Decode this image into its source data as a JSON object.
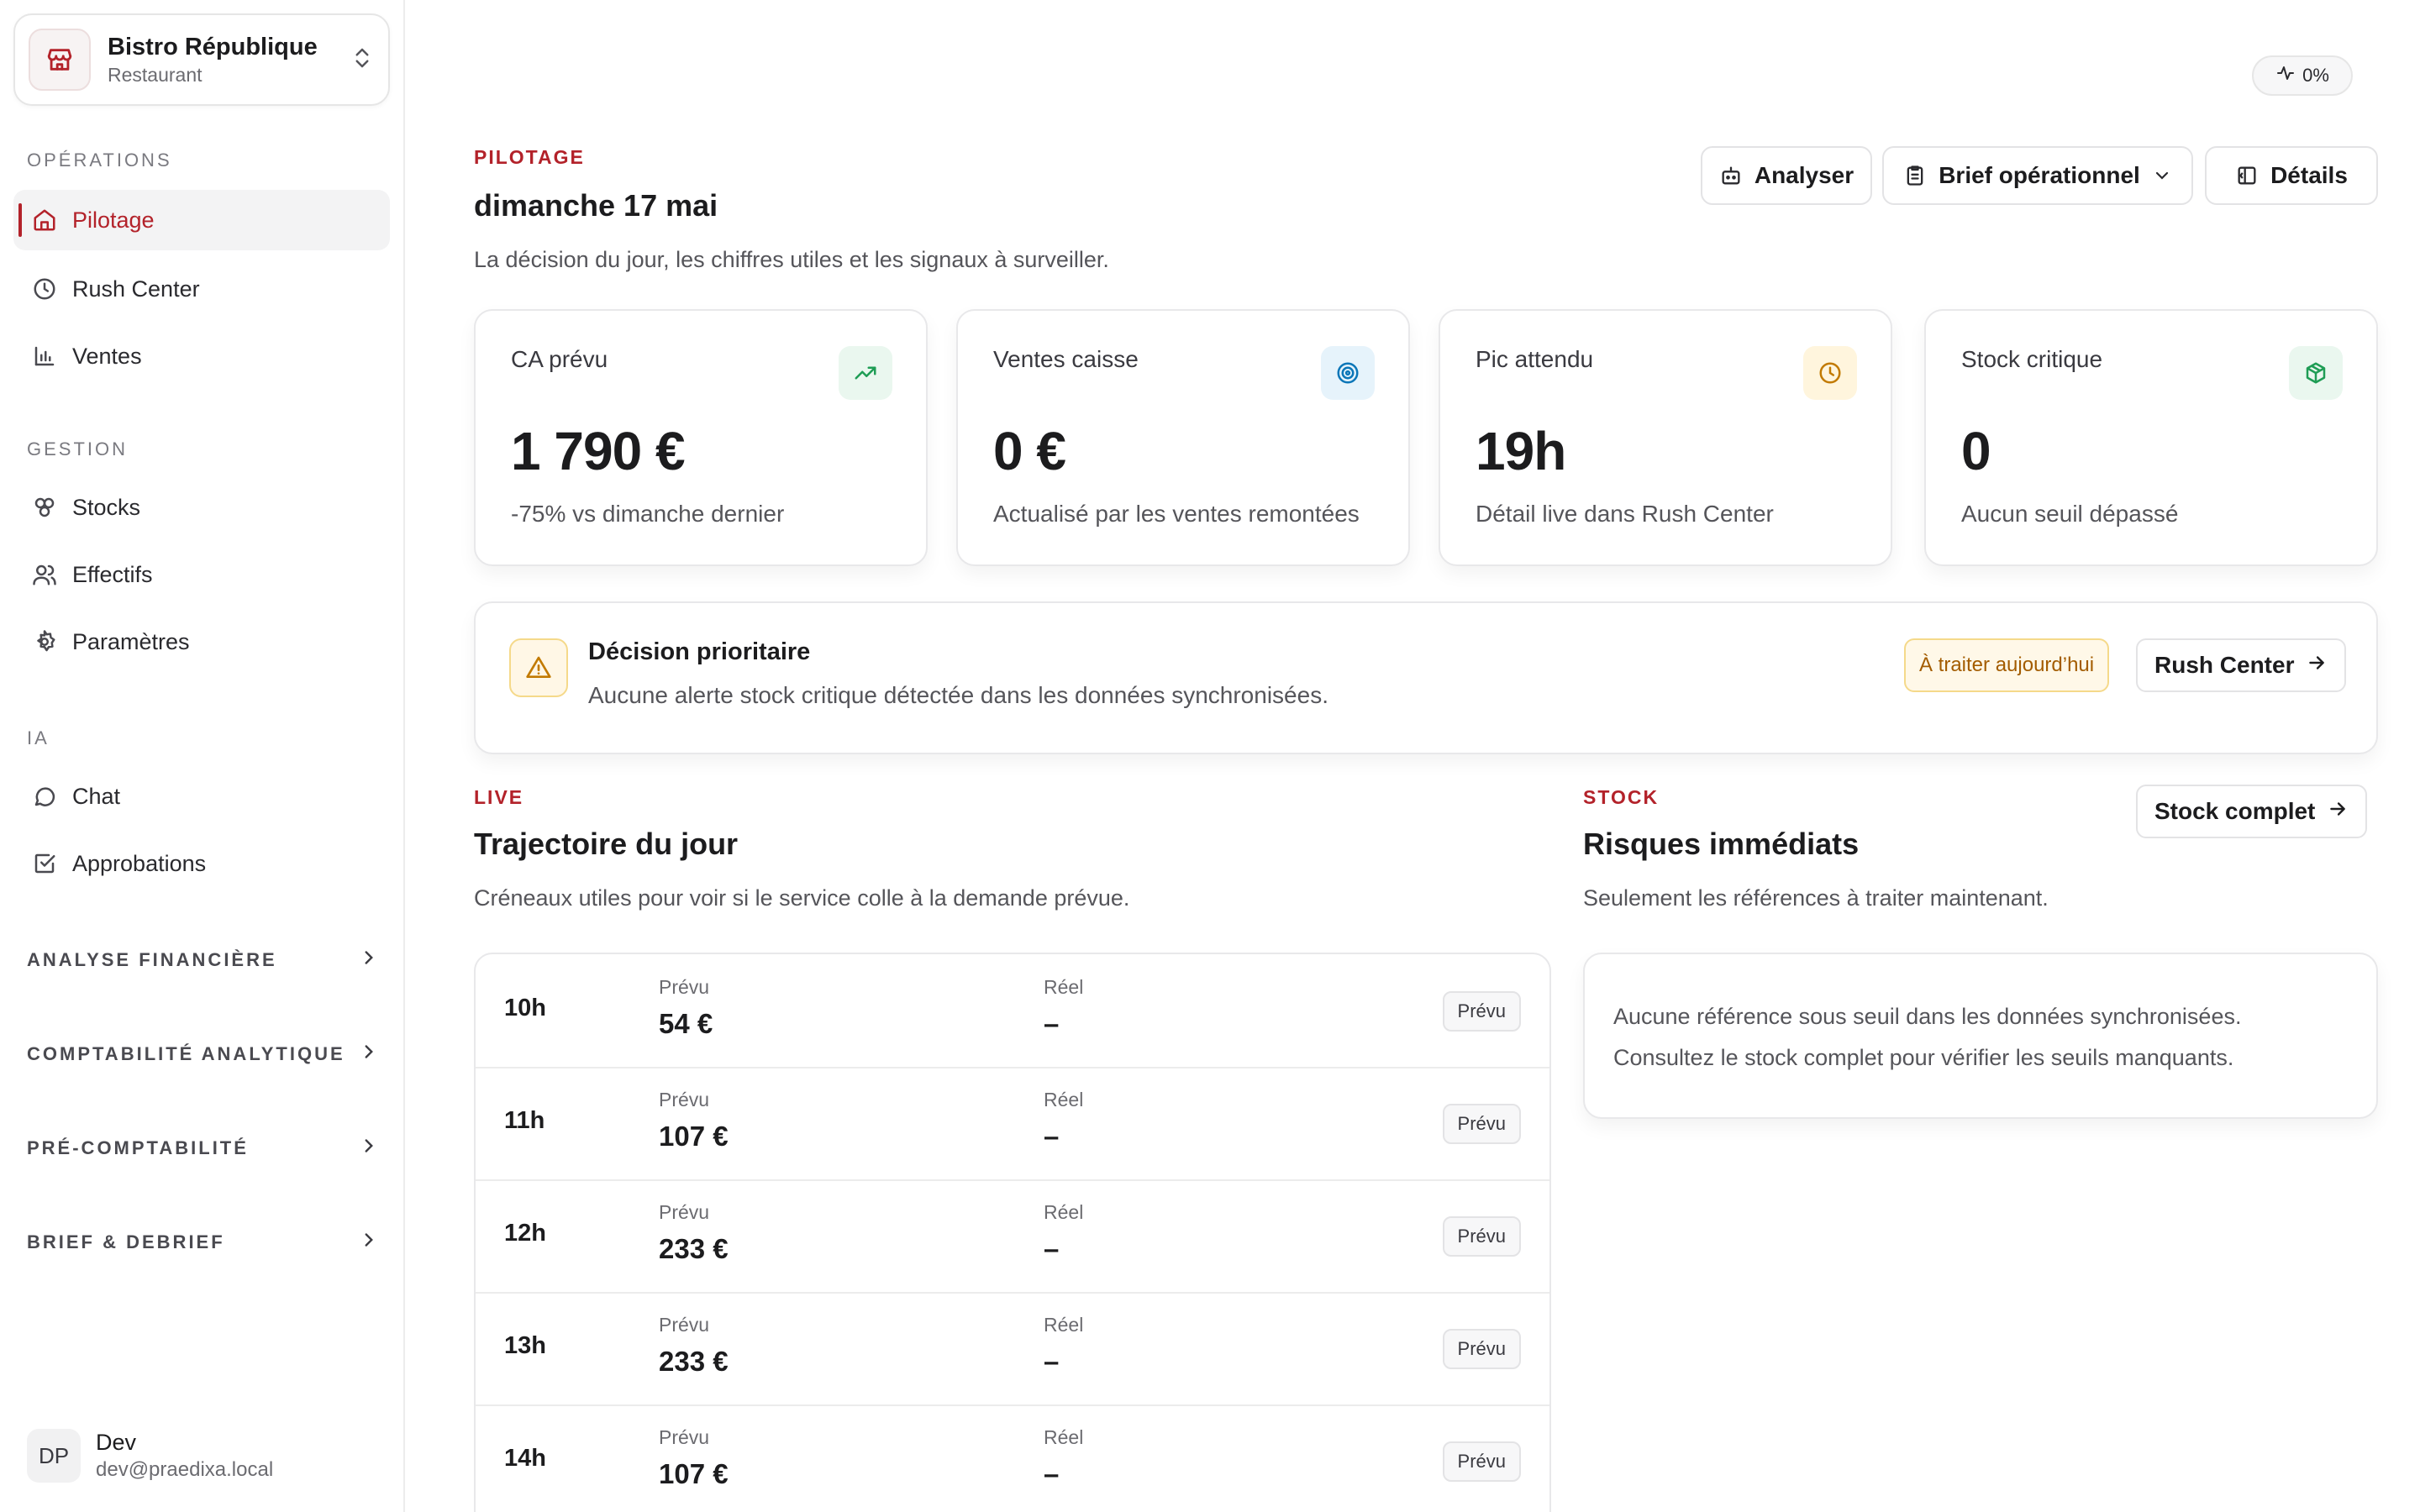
{
  "org": {
    "name": "Bistro République",
    "type": "Restaurant"
  },
  "sidebar": {
    "section_operations": "OPÉRATIONS",
    "section_gestion": "GESTION",
    "section_ia": "IA",
    "items": [
      {
        "label": "Pilotage",
        "icon": "home-icon"
      },
      {
        "label": "Rush Center",
        "icon": "clock-icon"
      },
      {
        "label": "Ventes",
        "icon": "bar-chart-icon"
      },
      {
        "label": "Stocks",
        "icon": "boxes-icon"
      },
      {
        "label": "Effectifs",
        "icon": "users-icon"
      },
      {
        "label": "Paramètres",
        "icon": "gear-icon"
      },
      {
        "label": "Chat",
        "icon": "chat-icon"
      },
      {
        "label": "Approbations",
        "icon": "check-square-icon"
      }
    ],
    "groups": [
      {
        "label": "ANALYSE FINANCIÈRE"
      },
      {
        "label": "COMPTABILITÉ ANALYTIQUE"
      },
      {
        "label": "PRÉ-COMPTABILITÉ"
      },
      {
        "label": "BRIEF & DEBRIEF"
      }
    ]
  },
  "user": {
    "initials": "DP",
    "name": "Dev",
    "email": "dev@praedixa.local"
  },
  "activity": {
    "value": "0%"
  },
  "header": {
    "eyebrow": "PILOTAGE",
    "title": "dimanche 17 mai",
    "subtitle": "La décision du jour, les chiffres utiles et les signaux à surveiller."
  },
  "toolbar": {
    "analyze": "Analyser",
    "brief": "Brief opérationnel",
    "details": "Détails"
  },
  "kpis": [
    {
      "label": "CA prévu",
      "value": "1 790 €",
      "note": "-75% vs dimanche dernier",
      "icon": "trending-up-icon",
      "color": "#1f9d55",
      "bg": "#eaf7ef"
    },
    {
      "label": "Ventes caisse",
      "value": "0 €",
      "note": "Actualisé par les ventes remontées",
      "icon": "target-icon",
      "color": "#0b76b8",
      "bg": "#e6f3fb"
    },
    {
      "label": "Pic attendu",
      "value": "19h",
      "note": "Détail live dans Rush Center",
      "icon": "clock-icon",
      "color": "#c27a00",
      "bg": "#fff5dd"
    },
    {
      "label": "Stock critique",
      "value": "0",
      "note": "Aucun seuil dépassé",
      "icon": "package-icon",
      "color": "#1f9d55",
      "bg": "#eaf7ef"
    }
  ],
  "decision": {
    "title": "Décision prioritaire",
    "text": "Aucune alerte stock critique détectée dans les données synchronisées.",
    "badge": "À traiter aujourd’hui",
    "action": "Rush Center"
  },
  "live": {
    "eyebrow": "LIVE",
    "title": "Trajectoire du jour",
    "subtitle": "Créneaux utiles pour voir si le service colle à la demande prévue.",
    "rows": [
      {
        "hour": "10h",
        "forecast_label": "Prévu",
        "forecast": "54 €",
        "actual_label": "Réel",
        "actual": "–",
        "status": "Prévu"
      },
      {
        "hour": "11h",
        "forecast_label": "Prévu",
        "forecast": "107 €",
        "actual_label": "Réel",
        "actual": "–",
        "status": "Prévu"
      },
      {
        "hour": "12h",
        "forecast_label": "Prévu",
        "forecast": "233 €",
        "actual_label": "Réel",
        "actual": "–",
        "status": "Prévu"
      },
      {
        "hour": "13h",
        "forecast_label": "Prévu",
        "forecast": "233 €",
        "actual_label": "Réel",
        "actual": "–",
        "status": "Prévu"
      },
      {
        "hour": "14h",
        "forecast_label": "Prévu",
        "forecast": "107 €",
        "actual_label": "Réel",
        "actual": "–",
        "status": "Prévu"
      }
    ]
  },
  "stock": {
    "eyebrow": "STOCK",
    "title": "Risques immédiats",
    "subtitle": "Seulement les références à traiter maintenant.",
    "action": "Stock complet",
    "empty_line1": "Aucune référence sous seuil dans les données synchronisées.",
    "empty_line2": "Consultez le stock complet pour vérifier les seuils manquants."
  }
}
